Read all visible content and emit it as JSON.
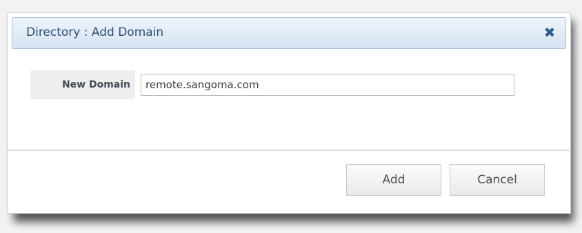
{
  "dialog": {
    "title": "Directory : Add Domain",
    "close_glyph": "✖"
  },
  "form": {
    "new_domain_label": "New Domain",
    "new_domain_value": "remote.sangoma.com"
  },
  "buttons": {
    "add_label": "Add",
    "cancel_label": "Cancel"
  },
  "icons": {
    "close": "close-icon"
  },
  "colors": {
    "title_text": "#2b4e78",
    "title_bar_top": "#eef4fb",
    "title_bar_bottom": "#d6e3f1",
    "close_icon": "#2f5d8f"
  }
}
